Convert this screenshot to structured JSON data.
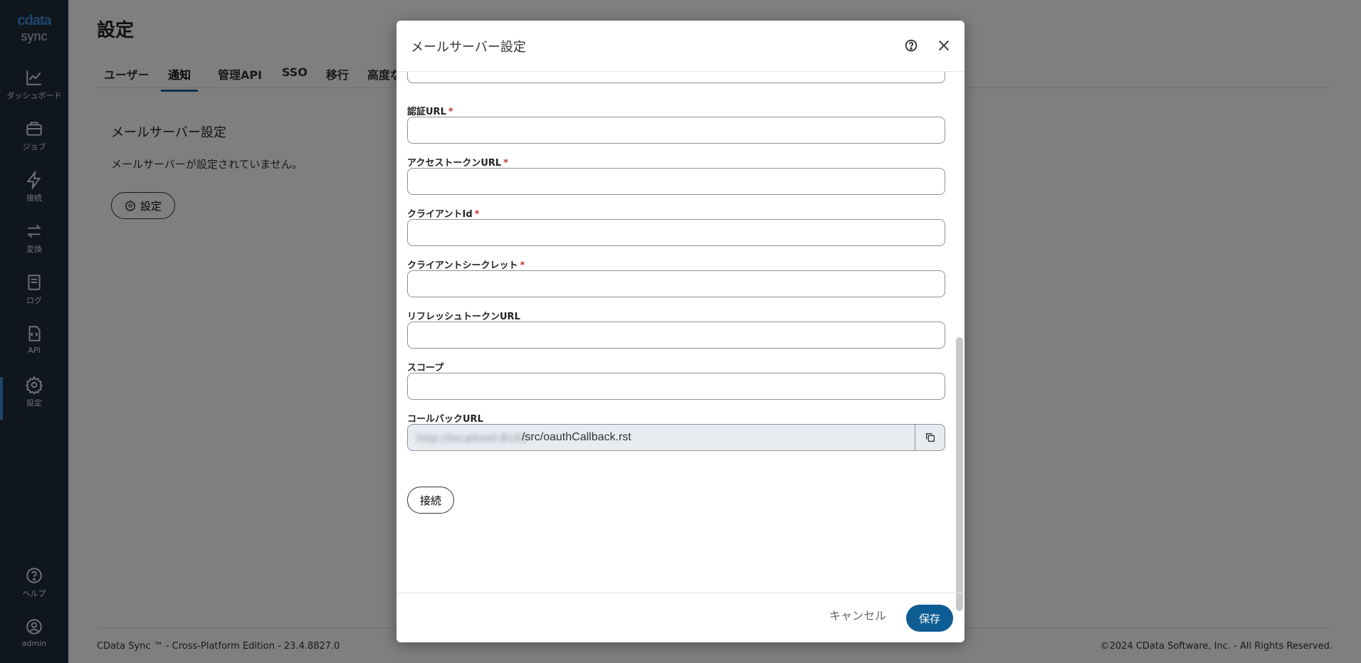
{
  "sidebar": {
    "logo_brand": "cdata",
    "logo_product": "sync",
    "items": [
      {
        "label": "ダッシュボード",
        "icon": "chart-line-icon"
      },
      {
        "label": "ジョブ",
        "icon": "briefcase-icon"
      },
      {
        "label": "接続",
        "icon": "lightning-icon"
      },
      {
        "label": "変換",
        "icon": "arrows-exchange-icon"
      },
      {
        "label": "ログ",
        "icon": "book-icon"
      },
      {
        "label": "API",
        "icon": "code-file-icon"
      },
      {
        "label": "設定",
        "icon": "gear-icon"
      }
    ],
    "bottom_items": [
      {
        "label": "ヘルプ",
        "icon": "question-circle-icon"
      },
      {
        "label": "admin",
        "icon": "user-circle-icon"
      }
    ],
    "accent_color": "#3d8fd6"
  },
  "page": {
    "title": "設定",
    "tabs": [
      "ユーザー",
      "通知",
      "管理API",
      "SSO",
      "移行",
      "高度な"
    ],
    "active_tab": "通知",
    "card": {
      "title": "メールサーバー設定",
      "description": "メールサーバーが設定されていません。",
      "button_label": "設定"
    },
    "footer_left": "CData Sync ™ - Cross-Platform Edition - 23.4.8827.0",
    "footer_right": "©2024 CData Software, Inc. - All Rights Reserved."
  },
  "modal": {
    "title": "メールサーバー設定",
    "fields": [
      {
        "label": "認証URL",
        "required": "*",
        "value": ""
      },
      {
        "label": "アクセストークンURL",
        "required": "*",
        "value": ""
      },
      {
        "label": "クライアントId",
        "required": "*",
        "value": ""
      },
      {
        "label": "クライアントシークレット",
        "required": "*",
        "value": ""
      },
      {
        "label": "リフレッシュトークンURL",
        "required": "",
        "value": ""
      },
      {
        "label": "スコープ",
        "required": "",
        "value": ""
      }
    ],
    "callback": {
      "label": "コールバックURL",
      "host_blurred": "http://localhost:8181",
      "path": "/src/oauthCallback.rst"
    },
    "connect_label": "接続",
    "cancel_label": "キャンセル",
    "save_label": "保存",
    "primary_color": "#0e5c94"
  }
}
